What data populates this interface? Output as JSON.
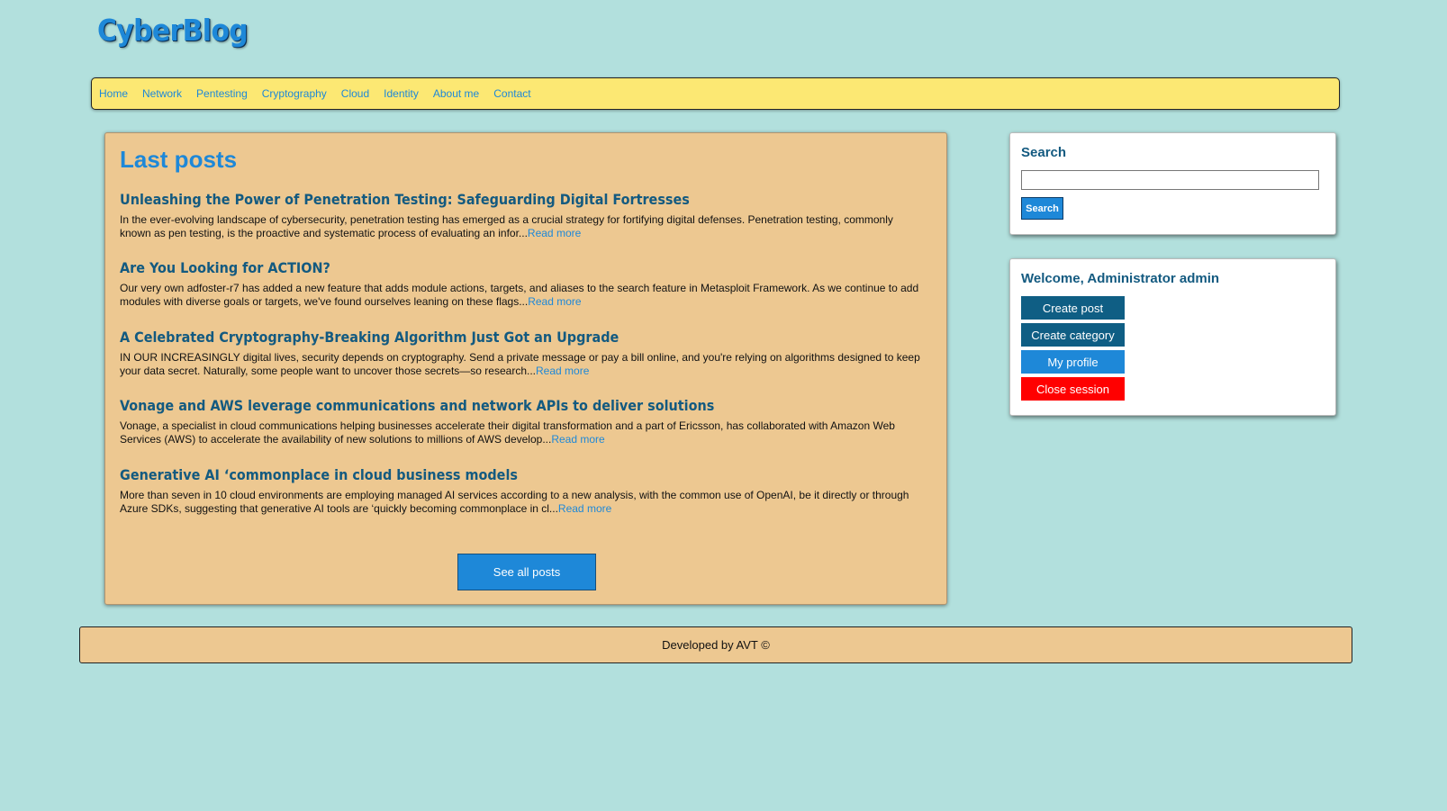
{
  "site": {
    "logo": "CyberBlog"
  },
  "nav": {
    "items": [
      "Home",
      "Network",
      "Pentesting",
      "Cryptography",
      "Cloud",
      "Identity",
      "About me",
      "Contact"
    ]
  },
  "main": {
    "title": "Last posts",
    "read_more_label": "Read more",
    "see_all_label": "See all posts",
    "posts": [
      {
        "title": "Unleashing the Power of Penetration Testing: Safeguarding Digital Fortresses",
        "excerpt": "In the ever-evolving landscape of cybersecurity, penetration testing has emerged as a crucial strategy for fortifying digital defenses. Penetration testing, commonly known as pen testing, is the proactive and systematic process of evaluating an infor..."
      },
      {
        "title": "Are You Looking for ACTION?",
        "excerpt": "Our very own adfoster-r7 has added a new feature that adds module actions, targets, and aliases to the search feature in Metasploit Framework. As we continue to add modules with diverse goals or targets, we've found ourselves leaning on these flags..."
      },
      {
        "title": "A Celebrated Cryptography-Breaking Algorithm Just Got an Upgrade",
        "excerpt": "IN OUR INCREASINGLY digital lives, security depends on cryptography. Send a private message or pay a bill online, and you're relying on algorithms designed to keep your data secret. Naturally, some people want to uncover those secrets—so research..."
      },
      {
        "title": "Vonage and AWS leverage communications and network APIs to deliver solutions",
        "excerpt": "Vonage, a specialist in cloud communications helping businesses accelerate their digital transformation and a part of Ericsson, has collaborated with Amazon Web Services (AWS) to accelerate the availability of new solutions to millions of AWS develop..."
      },
      {
        "title": "Generative AI ‘commonplace in cloud business models",
        "excerpt": "More than seven in 10 cloud environments are employing managed AI services according to a new analysis, with the common use of OpenAI, be it directly or through Azure SDKs, suggesting that generative AI tools are ‘quickly becoming commonplace in cl..."
      }
    ]
  },
  "search": {
    "title": "Search",
    "value": "",
    "button_label": "Search"
  },
  "admin": {
    "welcome": "Welcome, Administrator admin",
    "create_post": "Create post",
    "create_category": "Create category",
    "my_profile": "My profile",
    "close_session": "Close session"
  },
  "footer": {
    "text": "Developed by AVT ©"
  },
  "colors": {
    "background": "#b2e0dd",
    "nav_background": "#fce873",
    "panel_background": "#edc891",
    "accent_blue": "#1e88d8",
    "dark_teal": "#135a80",
    "admin_button_dark": "#0f5e84",
    "close_session_red": "#ff0000"
  }
}
